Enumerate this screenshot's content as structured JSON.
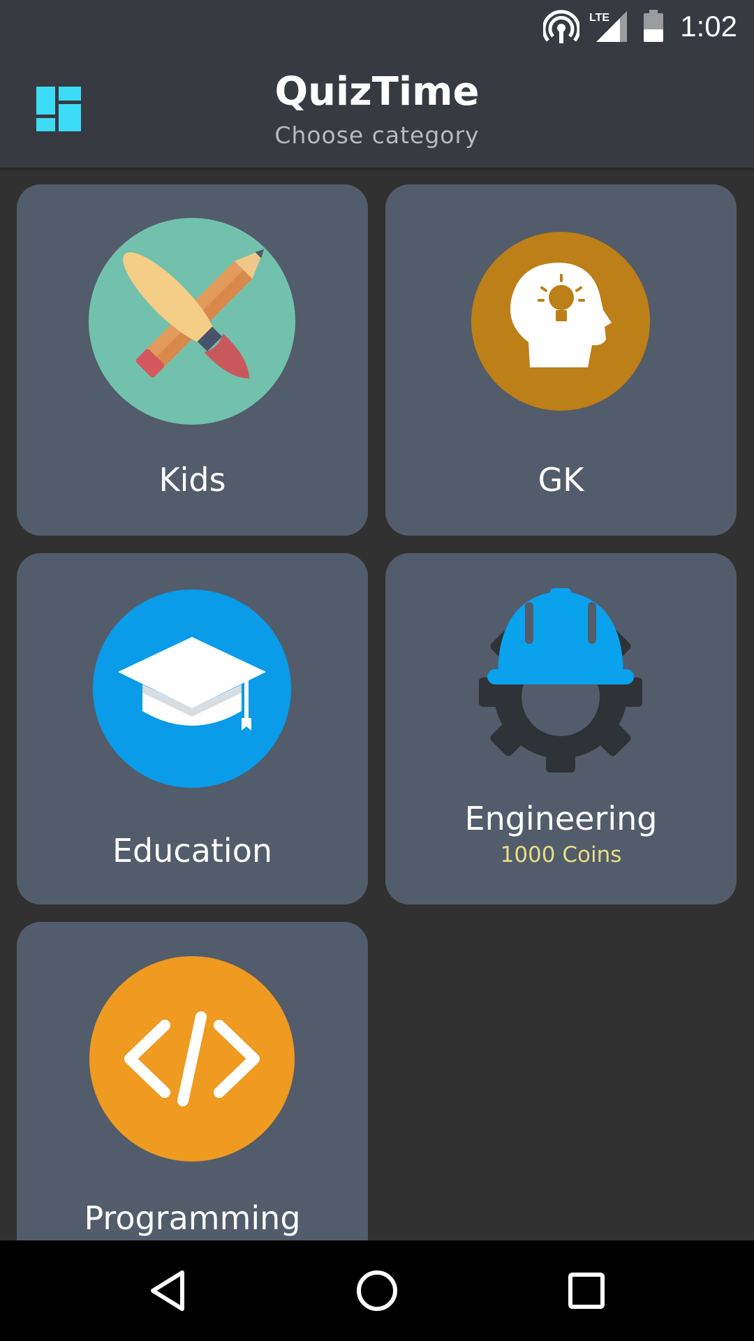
{
  "status_bar": {
    "time": "1:02",
    "network": "LTE",
    "icons": [
      "hotspot-icon",
      "lte-signal-icon",
      "battery-icon"
    ]
  },
  "app_bar": {
    "title": "QuizTime",
    "subtitle": "Choose category",
    "menu_icon": "dashboard-grid-icon",
    "accent_color": "#3ddcf6"
  },
  "categories": [
    {
      "label": "Kids",
      "icon": "pencil-brush-icon",
      "icon_bg": "#72c1ad"
    },
    {
      "label": "GK",
      "icon": "head-lightbulb-icon",
      "icon_bg": "#bd7f17"
    },
    {
      "label": "Education",
      "icon": "graduation-cap-icon",
      "icon_bg": "#0a9be9"
    },
    {
      "label": "Engineering",
      "sublabel": "1000 Coins",
      "icon": "hardhat-gear-icon",
      "icon_bg": "#0aa1ed"
    },
    {
      "label": "Programming",
      "icon": "code-brackets-icon",
      "icon_bg": "#ef9a20"
    }
  ],
  "nav_bar": {
    "buttons": [
      "back-icon",
      "home-icon",
      "recents-icon"
    ]
  }
}
